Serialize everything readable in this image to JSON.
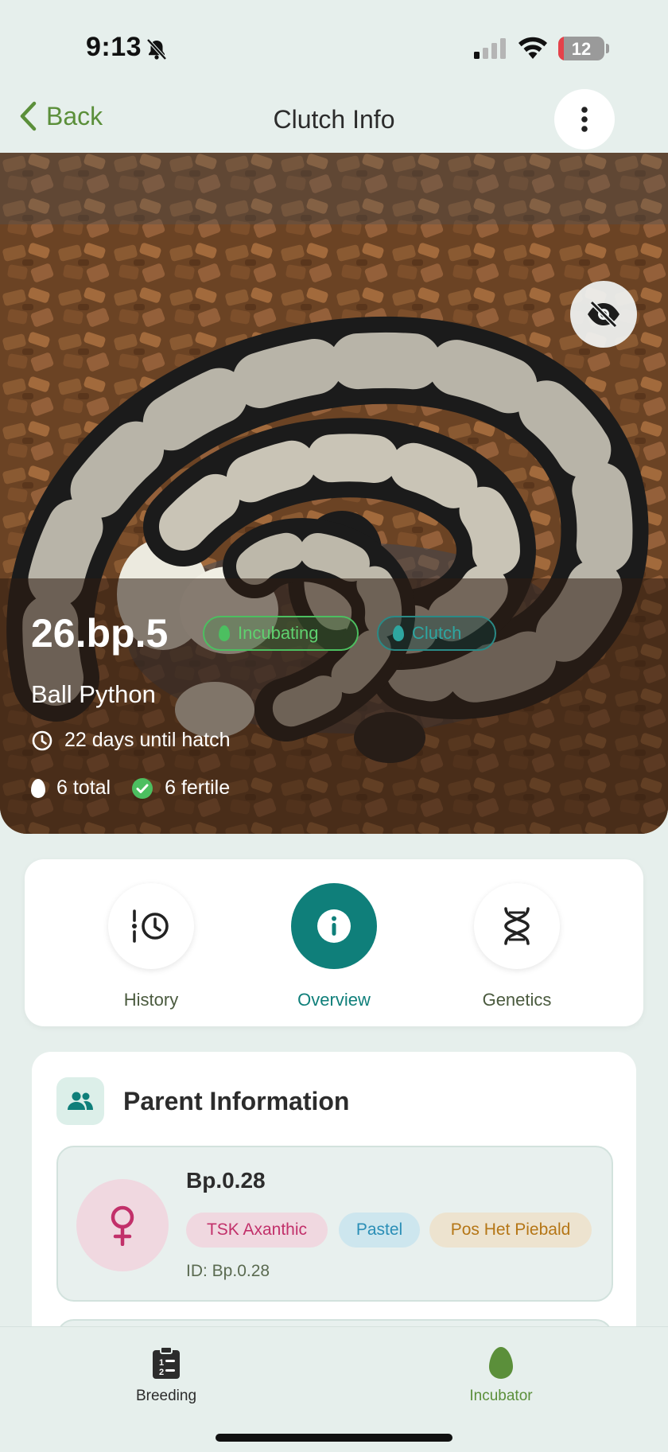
{
  "status_bar": {
    "time": "9:13",
    "battery": "12",
    "battery_level": 0.12
  },
  "header": {
    "back_label": "Back",
    "title": "Clutch Info"
  },
  "hero": {
    "clutch_id": "26.bp.5",
    "status_badge": "Incubating",
    "type_badge": "Clutch",
    "species": "Ball Python",
    "hatch_text": "22 days until hatch",
    "total_text": "6 total",
    "fertile_text": "6 fertile"
  },
  "tabs": [
    {
      "label": "History",
      "icon": "history-icon",
      "active": false
    },
    {
      "label": "Overview",
      "icon": "info-icon",
      "active": true
    },
    {
      "label": "Genetics",
      "icon": "dna-icon",
      "active": false
    }
  ],
  "parent_section": {
    "title": "Parent Information",
    "icon": "people-icon",
    "parents": [
      {
        "name": "Bp.0.28",
        "sex_icon": "female-icon",
        "genes": [
          "TSK Axanthic",
          "Pastel",
          "Pos Het Piebald"
        ],
        "id_text": "ID: Bp.0.28"
      }
    ]
  },
  "bottom_nav": {
    "items": [
      {
        "label": "Breeding",
        "icon": "clipboard-icon",
        "active": false
      },
      {
        "label": "Incubator",
        "icon": "egg-icon",
        "active": true
      }
    ]
  },
  "colors": {
    "background": "#e6efec",
    "accent_green": "#5b8f3a",
    "accent_teal": "#0f7f7a",
    "incubating_green": "#4cbf60",
    "female_pink": "#c2306a"
  }
}
